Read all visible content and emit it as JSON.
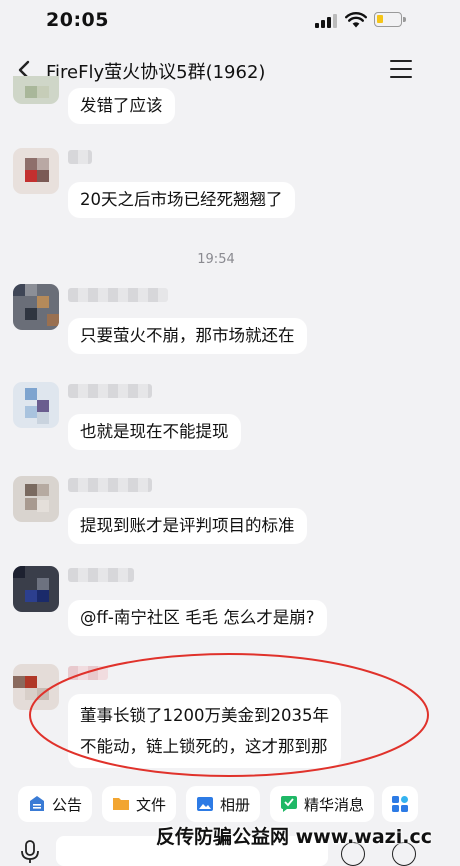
{
  "status_bar": {
    "time": "20:05"
  },
  "header": {
    "title": "FireFly萤火协议5群(1962)"
  },
  "timestamp": "19:54",
  "messages": [
    {
      "text": "发错了应该"
    },
    {
      "text": "20天之后市场已经死翘翘了"
    },
    {
      "text": "只要萤火不崩，那市场就还在"
    },
    {
      "text": "也就是现在不能提现"
    },
    {
      "text": "提现到账才是评判项目的标准"
    },
    {
      "text": "@ff-南宁社区  毛毛  怎么才是崩?"
    },
    {
      "text_line1": "董事长锁了1200万美金到2035年",
      "text_line2": "不能动，链上锁死的，这才那到那"
    }
  ],
  "toolbar": {
    "announcement": "公告",
    "files": "文件",
    "album": "相册",
    "highlights": "精华消息"
  },
  "watermark": "反传防骗公益网  www.wazi.cc",
  "colors": {
    "annotation": "#e0322b",
    "announcement_icon": "#3a7bd5",
    "files_icon": "#f2a531",
    "album_icon": "#2d7be5",
    "highlights_icon": "#1fb866",
    "more_icon": "#2d7be5"
  }
}
